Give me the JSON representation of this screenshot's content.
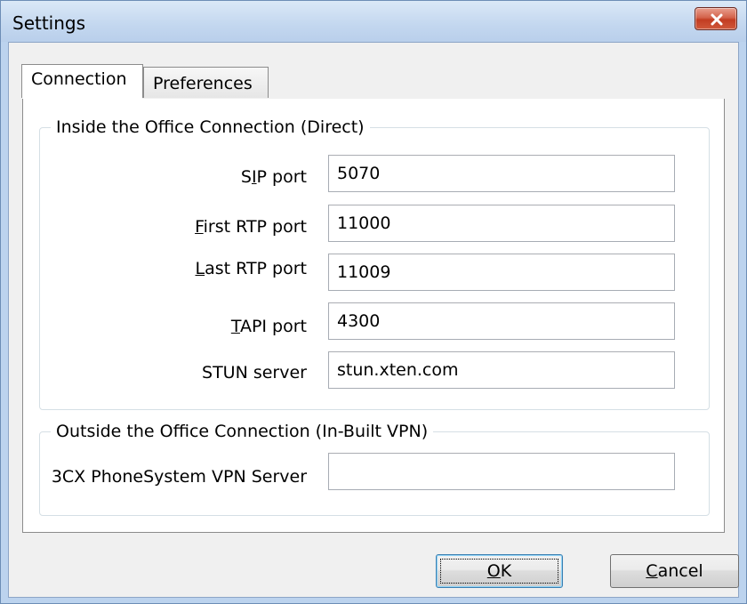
{
  "window": {
    "title": "Settings",
    "close_icon": "close-icon"
  },
  "tabs": [
    {
      "label": "Connection",
      "active": true
    },
    {
      "label": "Preferences",
      "active": false
    }
  ],
  "inside_group": {
    "legend": "Inside the Office Connection (Direct)",
    "fields": [
      {
        "label_pre": "S",
        "label_mn": "I",
        "label_post": "P port",
        "value": "5070"
      },
      {
        "label_pre": "",
        "label_mn": "F",
        "label_post": "irst RTP port",
        "value": "11000"
      },
      {
        "label_pre": "",
        "label_mn": "L",
        "label_post": "ast RTP port",
        "value": "11009"
      },
      {
        "label_pre": "",
        "label_mn": "T",
        "label_post": "API port",
        "value": "4300"
      },
      {
        "label_pre": "STUN server",
        "label_mn": "",
        "label_post": "",
        "value": "stun.xten.com"
      }
    ]
  },
  "outside_group": {
    "legend": "Outside the Office Connection (In-Built VPN)",
    "vpn_label": "3CX PhoneSystem VPN Server",
    "vpn_value": ""
  },
  "buttons": {
    "ok_mn": "O",
    "ok_rest": "K",
    "cancel_mn": "C",
    "cancel_rest": "ancel"
  },
  "colors": {
    "title_bar": "#c3d7ef",
    "close_button": "#c23d22",
    "ok_focus_border": "#3c7fb1"
  }
}
